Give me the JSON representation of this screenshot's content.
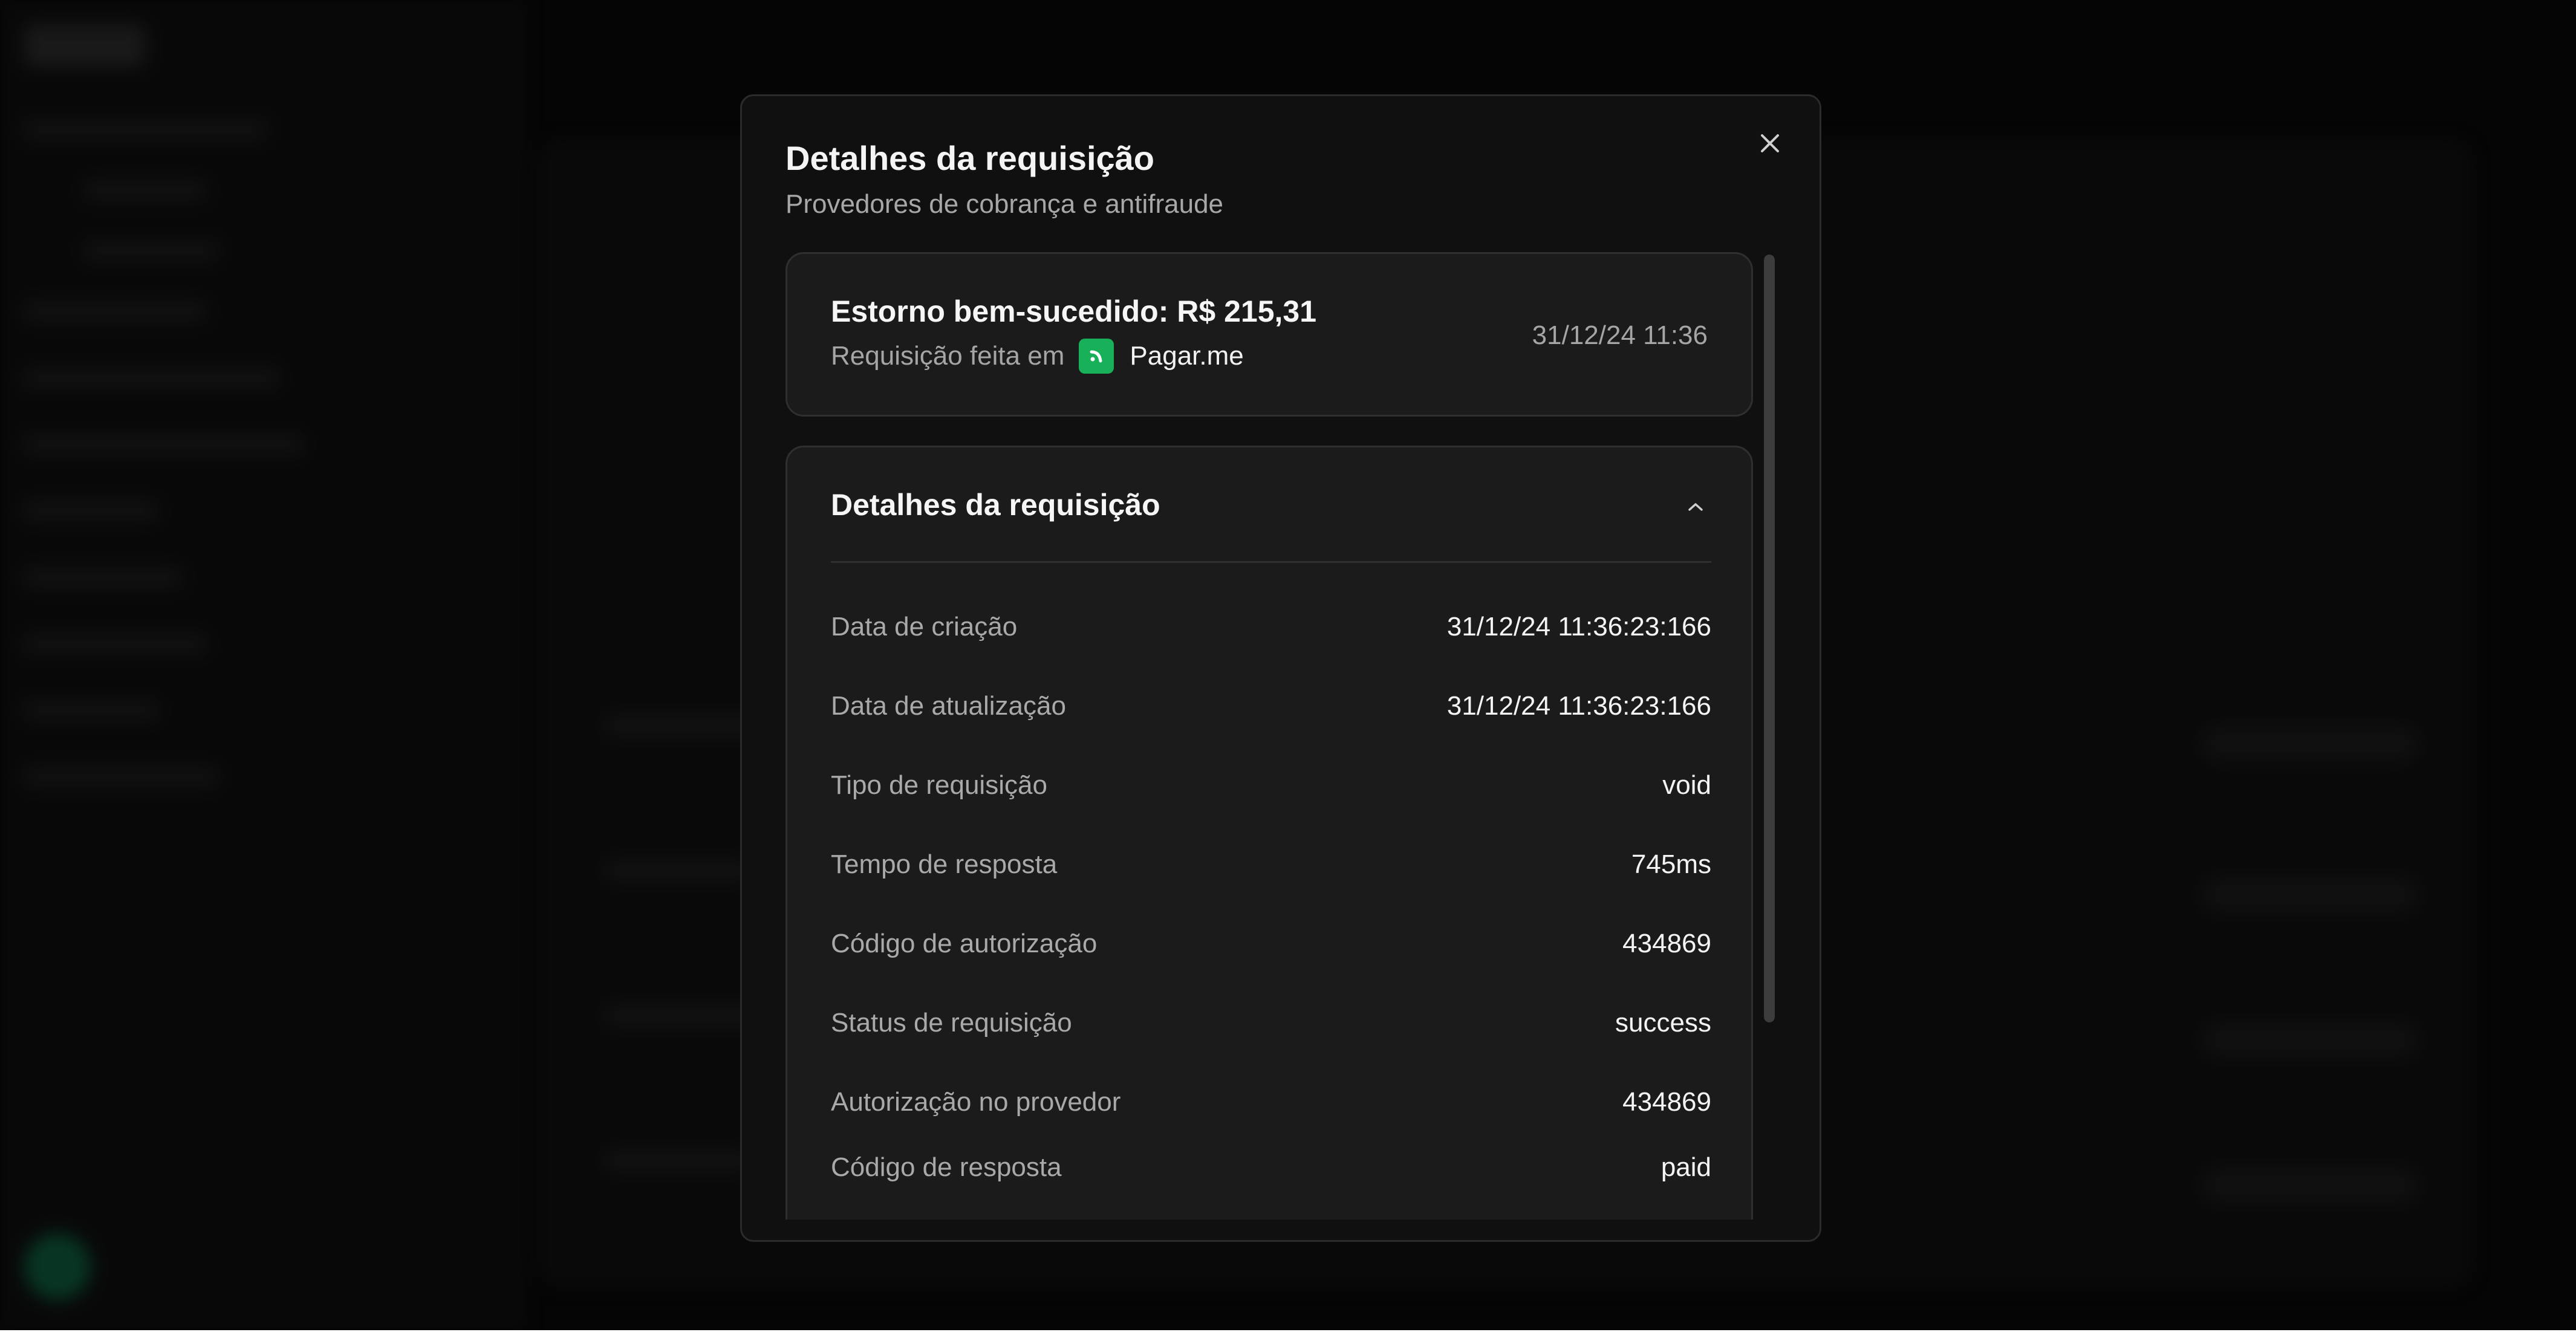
{
  "modal": {
    "title": "Detalhes da requisição",
    "subtitle": "Provedores de cobrança e antifraude"
  },
  "summary": {
    "title": "Estorno bem-sucedido: R$ 215,31",
    "prefix": "Requisição feita em",
    "provider": "Pagar.me",
    "time": "31/12/24 11:36"
  },
  "details": {
    "title": "Detalhes da requisição",
    "rows": [
      {
        "label": "Data de criação",
        "value": "31/12/24 11:36:23:166"
      },
      {
        "label": "Data de atualização",
        "value": "31/12/24 11:36:23:166"
      },
      {
        "label": "Tipo de requisição",
        "value": "void"
      },
      {
        "label": "Tempo de resposta",
        "value": "745ms"
      },
      {
        "label": "Código de autorização",
        "value": "434869"
      },
      {
        "label": "Status de requisição",
        "value": "success"
      },
      {
        "label": "Autorização no provedor",
        "value": "434869"
      },
      {
        "label": "Código de resposta",
        "value": "paid"
      }
    ]
  },
  "colors": {
    "provider_green": "#18b15a",
    "modal_bg": "#101010",
    "card_bg": "#1b1b1b"
  },
  "icons": [
    "close-icon",
    "pagarme-logo-icon",
    "chevron-up-icon"
  ]
}
